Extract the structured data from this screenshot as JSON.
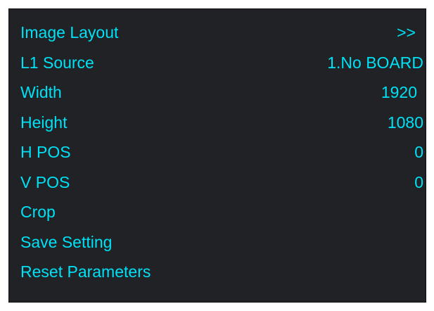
{
  "menu": {
    "items": [
      {
        "label": "Image Layout",
        "value": ">>"
      },
      {
        "label": "L1 Source",
        "value": "1.No BOARD"
      },
      {
        "label": "Width",
        "value": "1920"
      },
      {
        "label": "Height",
        "value": "1080"
      },
      {
        "label": "H POS",
        "value": "0"
      },
      {
        "label": "V POS",
        "value": "0"
      },
      {
        "label": "Crop",
        "value": ""
      },
      {
        "label": "Save Setting",
        "value": ""
      },
      {
        "label": "Reset Parameters",
        "value": ""
      }
    ]
  },
  "colors": {
    "background": "#202226",
    "text": "#00e1f5"
  }
}
